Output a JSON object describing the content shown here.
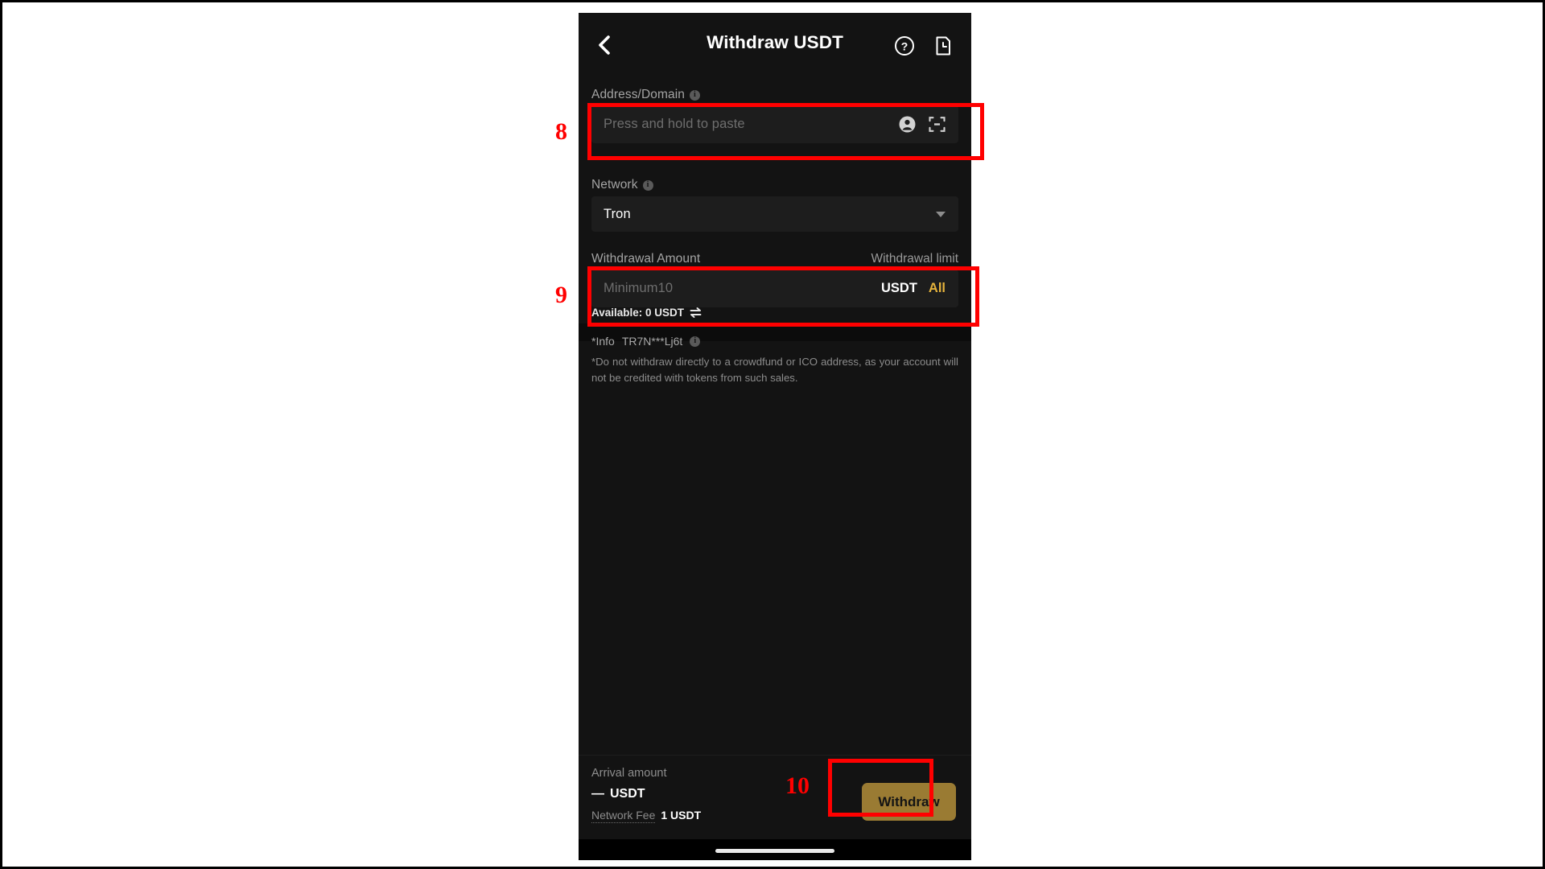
{
  "header": {
    "back_icon": "chevron-left-icon",
    "title": "Withdraw USDT",
    "help_icon": "question-circle-icon",
    "history_icon": "document-clock-icon"
  },
  "address_field": {
    "label": "Address/Domain",
    "info_icon": "info-icon",
    "placeholder": "Press and hold to paste",
    "value": "",
    "contacts_icon": "contact-person-icon",
    "scan_icon": "qr-scan-icon"
  },
  "network_field": {
    "label": "Network",
    "info_icon": "info-icon",
    "selected": "Tron",
    "caret_icon": "chevron-down-icon"
  },
  "amount_field": {
    "label": "Withdrawal Amount",
    "limit_label": "Withdrawal limit",
    "placeholder": "Minimum10",
    "value": "",
    "unit": "USDT",
    "all_label": "All",
    "available_text": "Available: 0 USDT",
    "swap_icon": "swap-arrows-icon"
  },
  "info_section": {
    "info_label": "*Info",
    "info_address": "TR7N***Lj6t",
    "info_icon": "info-icon",
    "note": "*Do not withdraw directly to a crowdfund or ICO address, as your account will not be credited with tokens from such sales."
  },
  "footer": {
    "arrival_label": "Arrival amount",
    "arrival_value": "—",
    "arrival_unit": "USDT",
    "fee_label": "Network Fee",
    "fee_value": "1 USDT",
    "withdraw_label": "Withdraw"
  },
  "annotations": {
    "address": "8",
    "amount": "9",
    "withdraw": "10",
    "color": "#ff0000"
  },
  "theme": {
    "page_bg": "#131313",
    "input_bg": "#1d1d1d",
    "accent_gold": "#e4b23c",
    "button_gold": "#9a7b33"
  }
}
